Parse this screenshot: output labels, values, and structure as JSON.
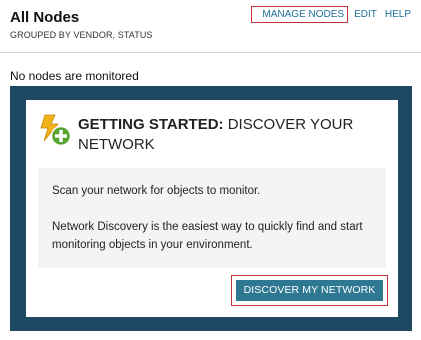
{
  "header": {
    "title": "All Nodes",
    "subtitle": "GROUPED BY VENDOR, STATUS",
    "links": {
      "manage": "MANAGE NODES",
      "edit": "EDIT",
      "help": "HELP"
    }
  },
  "status": {
    "message": "No nodes are monitored"
  },
  "getting_started": {
    "title_strong": "GETTING STARTED:",
    "title_rest": " DISCOVER YOUR NETWORK",
    "line1": "Scan your network for objects to monitor.",
    "paragraph": "Network Discovery is the easiest way to quickly find and start monitoring objects in your environment.",
    "button_label": "DISCOVER MY NETWORK",
    "icon": "lightning-plus-icon"
  },
  "colors": {
    "panel_frame": "#1f4962",
    "button": "#2f7891",
    "link": "#1f6f9b",
    "highlight_border": "#c5323a"
  }
}
